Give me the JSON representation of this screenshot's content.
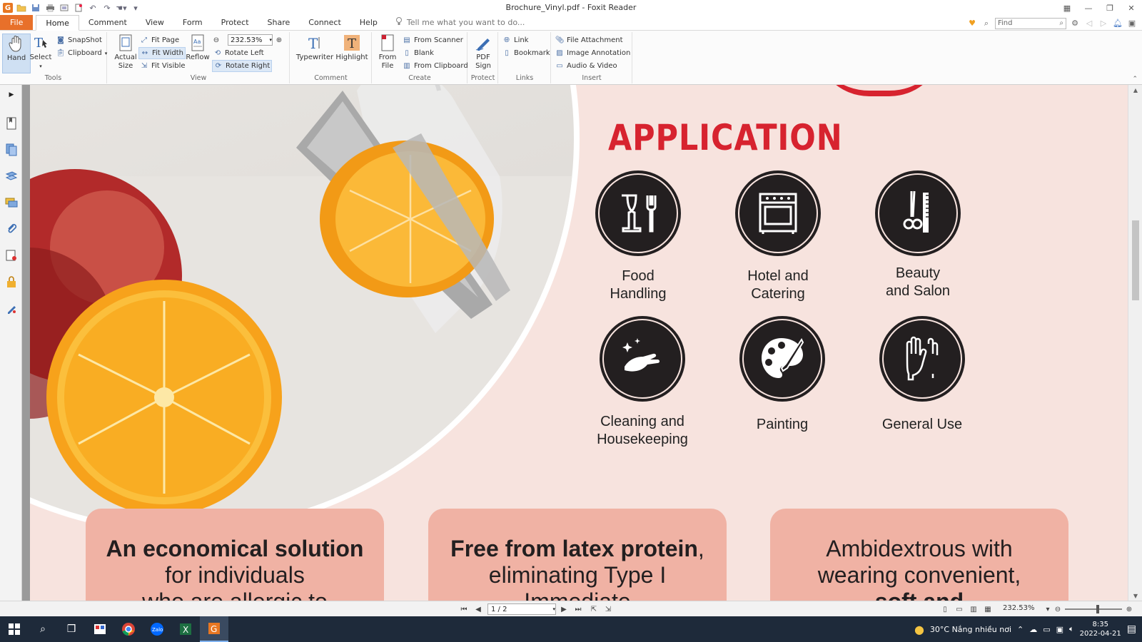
{
  "window": {
    "title": "Brochure_Vinyl.pdf - Foxit Reader"
  },
  "menu": {
    "tabs": [
      {
        "label": "File"
      },
      {
        "label": "Home"
      },
      {
        "label": "Comment"
      },
      {
        "label": "View"
      },
      {
        "label": "Form"
      },
      {
        "label": "Protect"
      },
      {
        "label": "Share"
      },
      {
        "label": "Connect"
      },
      {
        "label": "Help"
      }
    ],
    "tell_me": "Tell me what you want to do...",
    "find_placeholder": "Find"
  },
  "ribbon": {
    "tools": {
      "label": "Tools",
      "hand": "Hand",
      "select": "Select",
      "snapshot": "SnapShot",
      "clipboard": "Clipboard"
    },
    "view": {
      "label": "View",
      "actual_size": "Actual Size",
      "fit_page": "Fit Page",
      "fit_width": "Fit Width",
      "fit_visible": "Fit Visible",
      "reflow": "Reflow",
      "zoom_value": "232.53%",
      "rotate_left": "Rotate Left",
      "rotate_right": "Rotate Right"
    },
    "comment": {
      "label": "Comment",
      "typewriter": "Typewriter",
      "highlight": "Highlight"
    },
    "create": {
      "label": "Create",
      "from_file": "From File",
      "from_scanner": "From Scanner",
      "blank": "Blank",
      "from_clipboard": "From Clipboard"
    },
    "protect": {
      "label": "Protect",
      "pdf_sign": "PDF Sign"
    },
    "links": {
      "label": "Links",
      "link": "Link",
      "bookmark": "Bookmark"
    },
    "insert": {
      "label": "Insert",
      "file_attachment": "File Attachment",
      "image_annotation": "Image Annotation",
      "audio_video": "Audio & Video"
    }
  },
  "document": {
    "heading": "APPLICATION",
    "applications": [
      {
        "line1": "Food",
        "line2": "Handling",
        "icon": "glass-fork-icon"
      },
      {
        "line1": "Hotel and",
        "line2": "Catering",
        "icon": "stove-icon"
      },
      {
        "line1": "Beauty",
        "line2": "and Salon",
        "icon": "scissors-comb-icon"
      },
      {
        "line1": "Cleaning and",
        "line2": "Housekeeping",
        "icon": "cleaning-hand-icon"
      },
      {
        "line1": "Painting",
        "line2": "",
        "icon": "palette-icon"
      },
      {
        "line1": "General Use",
        "line2": "",
        "icon": "gloves-icon"
      }
    ],
    "cards": [
      {
        "bold": "An economical solution",
        "l2": "for individuals",
        "l3": "who are allergic to"
      },
      {
        "bold": "Free from latex protein",
        "rest": ",",
        "l2": "eliminating Type I",
        "l3": "Immediate"
      },
      {
        "l1": "Ambidextrous with",
        "l2": "wearing convenient,",
        "l3": "soft and"
      }
    ]
  },
  "status": {
    "page": "1 / 2",
    "zoom": "232.53%"
  },
  "taskbar": {
    "weather": "30°C  Nắng nhiều nơi",
    "time": "8:35",
    "date": "2022-04-21"
  },
  "colors": {
    "accent_red": "#d7232f",
    "page_bg": "#f7e3de",
    "card_bg": "#f0b2a4",
    "file_tab": "#e8702a"
  }
}
